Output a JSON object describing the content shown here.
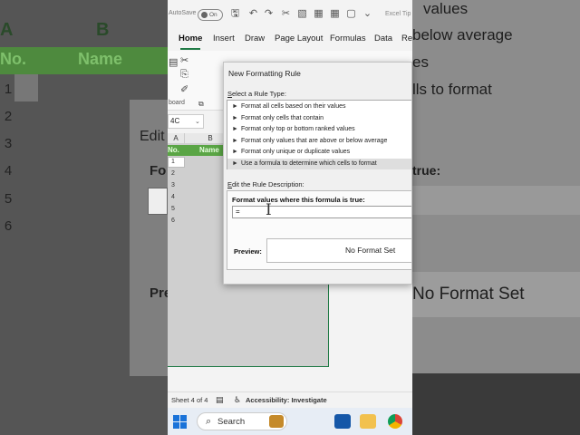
{
  "background": {
    "col_a": "A",
    "col_b": "B",
    "header_no": "No.",
    "header_name": "Name",
    "row_numbers": [
      "1",
      "2",
      "3",
      "4",
      "5",
      "6"
    ],
    "edit_label": "Edit",
    "format_label": "Fo",
    "pre_label": "Pre",
    "right_line_1": "values",
    "right_line_2": "below average",
    "right_line_3": "es",
    "right_line_4": "lls to format",
    "right_true": "true:",
    "right_no_format": "No Format Set"
  },
  "excel": {
    "autosave_label": "AutoSave",
    "autosave_state": "On",
    "file_title": "Excel Tip",
    "tabs": [
      "Home",
      "Insert",
      "Draw",
      "Page Layout",
      "Formulas",
      "Data",
      "Rev"
    ],
    "clipboard_label": "board",
    "name_box": "4C",
    "grid": {
      "col_a": "A",
      "col_b": "B",
      "header_no": "No.",
      "header_name": "Name",
      "row_numbers": [
        "1",
        "2",
        "3",
        "4",
        "5",
        "6"
      ]
    },
    "status": {
      "sheet": "Sheet 4 of 4",
      "accessibility": "Accessibility: Investigate"
    },
    "taskbar": {
      "search_text": "Search"
    }
  },
  "dialog": {
    "title": "New Formatting Rule",
    "select_label_prefix": "S",
    "select_label_rest": "elect a Rule Type:",
    "rule_types": [
      "Format all cells based on their values",
      "Format only cells that contain",
      "Format only top or bottom ranked values",
      "Format only values that are above or below average",
      "Format only unique or duplicate values",
      "Use a formula to determine which cells to format"
    ],
    "selected_index": 5,
    "edit_label_prefix": "E",
    "edit_label_rest": "dit the Rule Description:",
    "format_values_label": "Format values where this formula is true:",
    "formula_value": "=",
    "preview_label": "Preview:",
    "preview_text": "No Format Set"
  },
  "colors": {
    "excel_green": "#1f7a45",
    "header_green": "#5aa545",
    "windows_blue": "#1a73d9"
  }
}
